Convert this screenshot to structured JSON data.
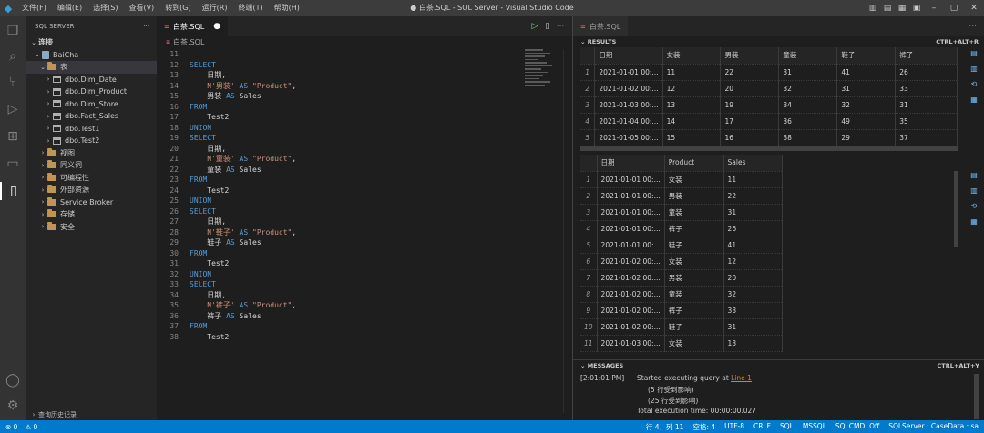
{
  "window": {
    "title": "● 白茶.SQL - SQL Server - Visual Studio Code",
    "menu": [
      "文件(F)",
      "编辑(E)",
      "选择(S)",
      "查看(V)",
      "转到(G)",
      "运行(R)",
      "终端(T)",
      "帮助(H)"
    ]
  },
  "sidebar": {
    "header": "SQL SERVER",
    "more": "···",
    "connections_label": "连接",
    "server": "BaiCha",
    "tables_folder": "表",
    "tables": [
      "dbo.Dim_Date",
      "dbo.Dim_Product",
      "dbo.Dim_Store",
      "dbo.Fact_Sales",
      "dbo.Test1",
      "dbo.Test2"
    ],
    "folders": [
      "视图",
      "同义词",
      "可编程性",
      "外部资源",
      "Service Broker",
      "存储",
      "安全"
    ],
    "footer": "查询历史记录"
  },
  "editor": {
    "tab_label": "白茶.SQL",
    "tab_dirty": "●",
    "breadcrumb": "白茶.SQL",
    "code_lines": [
      {
        "n": "11",
        "t": ""
      },
      {
        "n": "12",
        "t": "SELECT"
      },
      {
        "n": "13",
        "t": "    日期,"
      },
      {
        "n": "14",
        "t": "    N'男装' AS \"Product\","
      },
      {
        "n": "15",
        "t": "    男装 AS Sales"
      },
      {
        "n": "16",
        "t": "FROM"
      },
      {
        "n": "17",
        "t": "    Test2"
      },
      {
        "n": "18",
        "t": "UNION"
      },
      {
        "n": "19",
        "t": "SELECT"
      },
      {
        "n": "20",
        "t": "    日期,"
      },
      {
        "n": "21",
        "t": "    N'童装' AS \"Product\","
      },
      {
        "n": "22",
        "t": "    童装 AS Sales"
      },
      {
        "n": "23",
        "t": "FROM"
      },
      {
        "n": "24",
        "t": "    Test2"
      },
      {
        "n": "25",
        "t": "UNION"
      },
      {
        "n": "26",
        "t": "SELECT"
      },
      {
        "n": "27",
        "t": "    日期,"
      },
      {
        "n": "28",
        "t": "    N'鞋子' AS \"Product\","
      },
      {
        "n": "29",
        "t": "    鞋子 AS Sales"
      },
      {
        "n": "30",
        "t": "FROM"
      },
      {
        "n": "31",
        "t": "    Test2"
      },
      {
        "n": "32",
        "t": "UNION"
      },
      {
        "n": "33",
        "t": "SELECT"
      },
      {
        "n": "34",
        "t": "    日期,"
      },
      {
        "n": "35",
        "t": "    N'裤子' AS \"Product\","
      },
      {
        "n": "36",
        "t": "    裤子 AS Sales"
      },
      {
        "n": "37",
        "t": "FROM"
      },
      {
        "n": "38",
        "t": "    Test2"
      }
    ]
  },
  "results": {
    "tab_label": "白茶.SQL",
    "results_header": "RESULTS",
    "results_shortcut": "CTRL+ALT+R",
    "messages_header": "MESSAGES",
    "messages_shortcut": "CTRL+ALT+Y",
    "grid1": {
      "columns": [
        "日期",
        "女装",
        "男装",
        "童装",
        "鞋子",
        "裤子"
      ],
      "rows": [
        [
          "1",
          "2021-01-01 00:...",
          "11",
          "22",
          "31",
          "41",
          "26"
        ],
        [
          "2",
          "2021-01-02 00:...",
          "12",
          "20",
          "32",
          "31",
          "33"
        ],
        [
          "3",
          "2021-01-03 00:...",
          "13",
          "19",
          "34",
          "32",
          "31"
        ],
        [
          "4",
          "2021-01-04 00:...",
          "14",
          "17",
          "36",
          "49",
          "35"
        ],
        [
          "5",
          "2021-01-05 00:...",
          "15",
          "16",
          "38",
          "29",
          "37"
        ]
      ]
    },
    "grid2": {
      "columns": [
        "日期",
        "Product",
        "Sales"
      ],
      "rows": [
        [
          "1",
          "2021-01-01 00:...",
          "女装",
          "11"
        ],
        [
          "2",
          "2021-01-01 00:...",
          "男装",
          "22"
        ],
        [
          "3",
          "2021-01-01 00:...",
          "童装",
          "31"
        ],
        [
          "4",
          "2021-01-01 00:...",
          "裤子",
          "26"
        ],
        [
          "5",
          "2021-01-01 00:...",
          "鞋子",
          "41"
        ],
        [
          "6",
          "2021-01-02 00:...",
          "女装",
          "12"
        ],
        [
          "7",
          "2021-01-02 00:...",
          "男装",
          "20"
        ],
        [
          "8",
          "2021-01-02 00:...",
          "童装",
          "32"
        ],
        [
          "9",
          "2021-01-02 00:...",
          "裤子",
          "33"
        ],
        [
          "10",
          "2021-01-02 00:...",
          "鞋子",
          "31"
        ],
        [
          "11",
          "2021-01-03 00:...",
          "女装",
          "13"
        ]
      ]
    },
    "messages": {
      "time": "[2:01:01 PM]",
      "started": "Started executing query at ",
      "line_link": "Line 1",
      "rows1": "(5 行受到影响)",
      "rows2": "(25 行受到影响)",
      "exec_time": "Total execution time: 00:00:00.027"
    }
  },
  "statusbar": {
    "errors": "⊗ 0",
    "warnings": "⚠ 0",
    "position": "行 4，列 11",
    "spaces": "空格: 4",
    "encoding": "UTF-8",
    "eol": "CRLF",
    "language": "SQL",
    "dialect": "MSSQL",
    "sqlcmd": "SQLCMD: Off",
    "connection": "SQLServer : CaseData : sa"
  },
  "colors": {
    "accent": "#007acc",
    "keyword": "#569cd6",
    "string": "#ce9178"
  }
}
